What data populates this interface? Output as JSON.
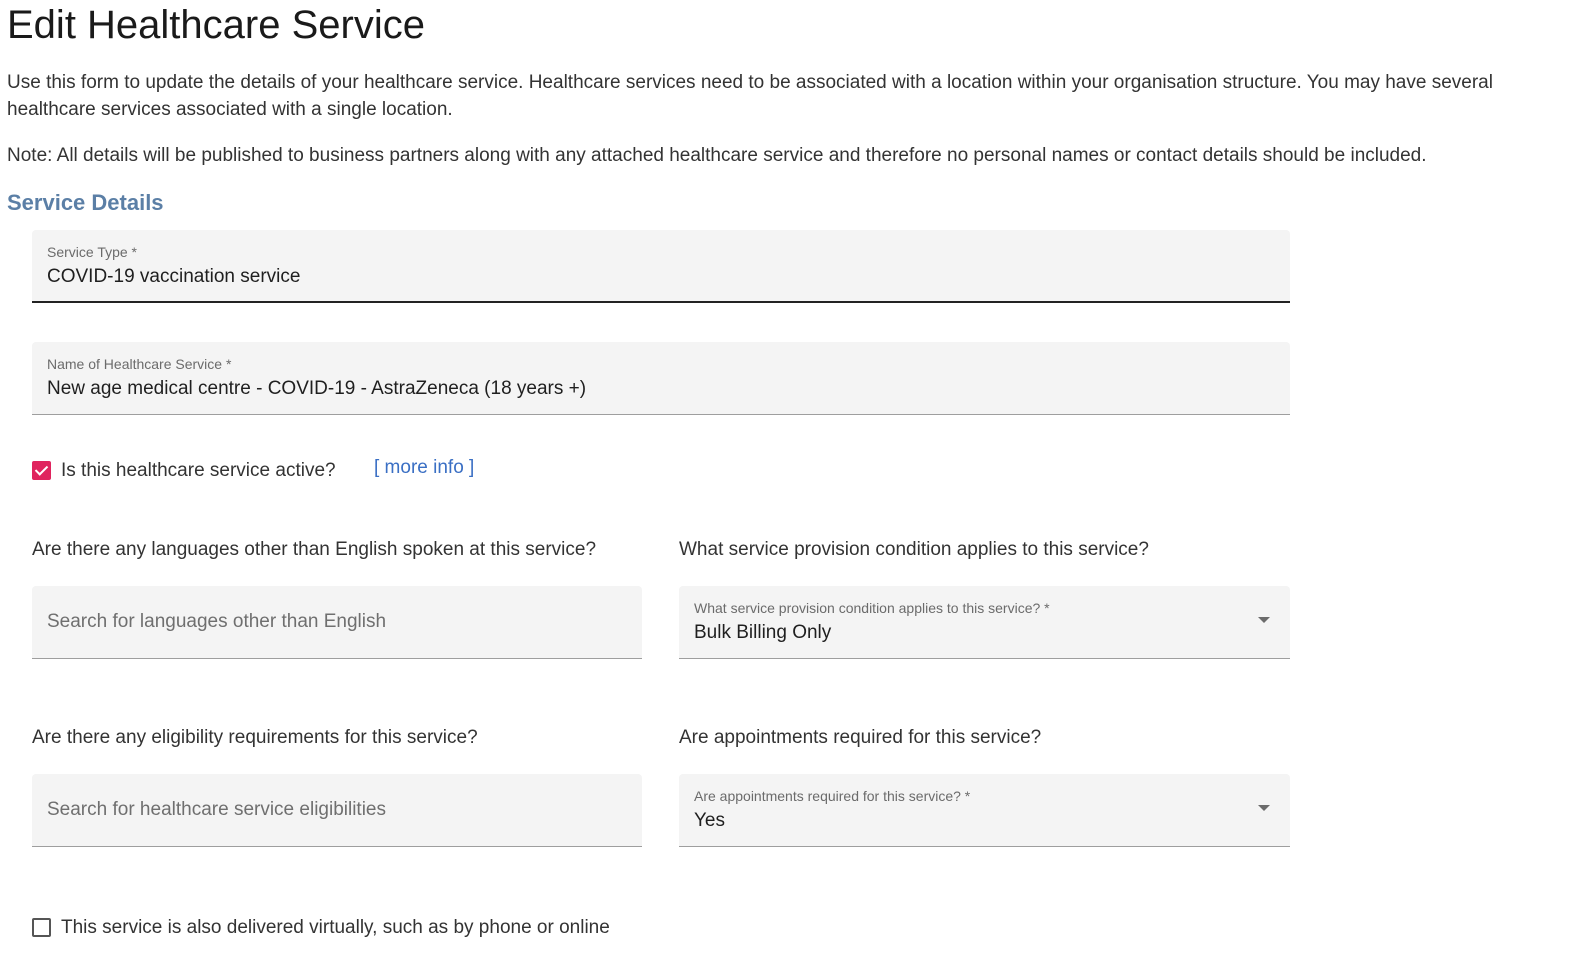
{
  "page": {
    "title": "Edit Healthcare Service",
    "intro": "Use this form to update the details of your healthcare service. Healthcare services need to be associated with a location within your organisation structure. You may have several healthcare services associated with a single location.",
    "note": "Note: All details will be published to business partners along with any attached healthcare service and therefore no personal names or contact details should be included."
  },
  "section": {
    "heading": "Service Details"
  },
  "service_type": {
    "label": "Service Type *",
    "value": "COVID-19 vaccination service"
  },
  "service_name": {
    "label": "Name of Healthcare Service *",
    "value": "New age medical centre - COVID-19 - AstraZeneca (18 years +)"
  },
  "active": {
    "label": "Is this healthcare service active?",
    "checked": true,
    "more_info": "[ more info ]"
  },
  "languages": {
    "question": "Are there any languages other than English spoken at this service?",
    "placeholder": "Search for languages other than English"
  },
  "provision": {
    "question": "What service provision condition applies to this service?",
    "label": "What service provision condition applies to this service? *",
    "value": "Bulk Billing Only"
  },
  "eligibility": {
    "question": "Are there any eligibility requirements for this service?",
    "placeholder": "Search for healthcare service eligibilities"
  },
  "appointments": {
    "question": "Are appointments required for this service?",
    "label": "Are appointments required for this service? *",
    "value": "Yes"
  },
  "virtual": {
    "label": "This service is also delivered virtually, such as by phone or online",
    "checked": false
  },
  "colors": {
    "accent": "#e0245e",
    "heading": "#5b7fa6",
    "link": "#3a6fc4",
    "field_bg": "#f4f4f4"
  }
}
